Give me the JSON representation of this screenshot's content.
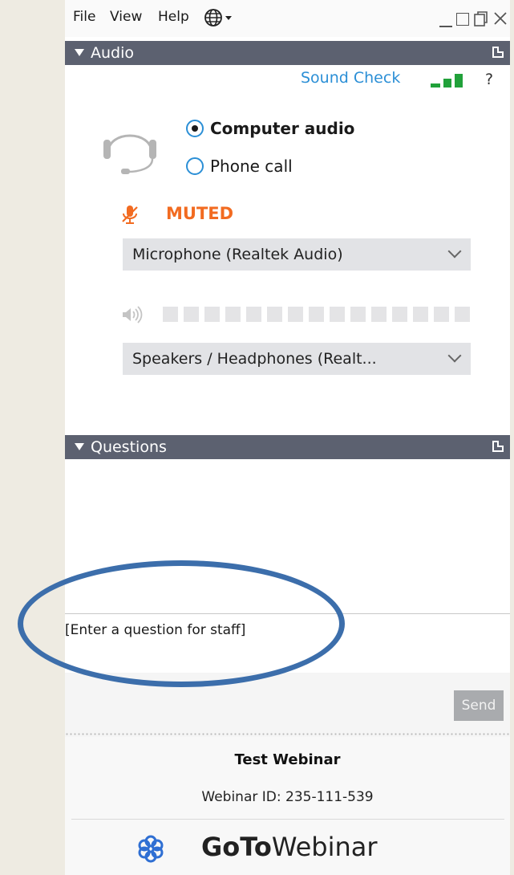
{
  "menu": {
    "file": "File",
    "view": "View",
    "help": "Help"
  },
  "audio": {
    "section_title": "Audio",
    "sound_check": "Sound Check",
    "help": "?",
    "options": [
      {
        "label": "Computer audio",
        "selected": true
      },
      {
        "label": "Phone call",
        "selected": false
      }
    ],
    "mic_status": "MUTED",
    "microphone": "Microphone (Realtek Audio)",
    "speakers": "Speakers / Headphones (Realt...",
    "output_level": 0,
    "accent_color": "#f26b21",
    "link_color": "#2b8fd6"
  },
  "questions": {
    "section_title": "Questions",
    "placeholder": "[Enter a question for staff]",
    "send_label": "Send"
  },
  "webinar": {
    "title": "Test Webinar",
    "id_line": "Webinar ID: 235-111-539"
  },
  "brand": {
    "goto": "GoTo",
    "webinar": "Webinar"
  }
}
